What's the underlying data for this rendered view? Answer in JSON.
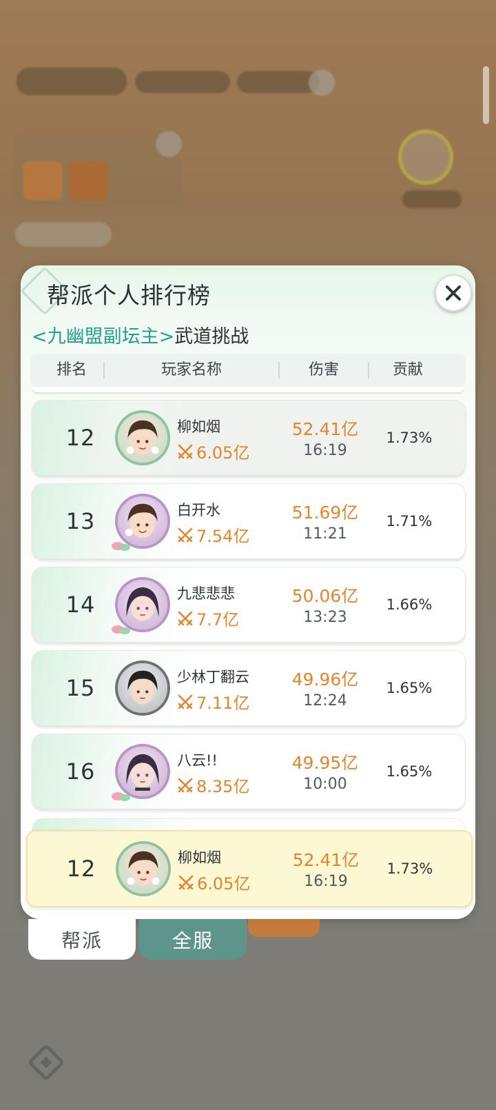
{
  "panel": {
    "title": "帮派个人排行榜",
    "subtitle_bracket": "<九幽盟副坛主>",
    "subtitle_rest": "武道挑战"
  },
  "columns": [
    "排名",
    "玩家名称",
    "伤害",
    "贡献"
  ],
  "rows": [
    {
      "rank": "12",
      "name": "柳如烟",
      "power": "6.05亿",
      "damage": "52.41亿",
      "time": "16:19",
      "share": "1.73%"
    },
    {
      "rank": "13",
      "name": "白开水",
      "power": "7.54亿",
      "damage": "51.69亿",
      "time": "11:21",
      "share": "1.71%"
    },
    {
      "rank": "14",
      "name": "九悲悲悲",
      "power": "7.7亿",
      "damage": "50.06亿",
      "time": "13:23",
      "share": "1.66%"
    },
    {
      "rank": "15",
      "name": "少林丁翻云",
      "power": "7.11亿",
      "damage": "49.96亿",
      "time": "12:24",
      "share": "1.65%"
    },
    {
      "rank": "16",
      "name": "八云!!",
      "power": "8.35亿",
      "damage": "49.95亿",
      "time": "10:00",
      "share": "1.65%"
    }
  ],
  "my_row": {
    "rank": "12",
    "name": "柳如烟",
    "power": "6.05亿",
    "damage": "52.41亿",
    "time": "16:19",
    "share": "1.73%"
  },
  "tabs": {
    "guild": "帮派",
    "server": "全服"
  },
  "icons": {
    "close": "close-icon",
    "power": "crossed-swords-icon",
    "bottom": "diamond-menu-icon"
  },
  "colors": {
    "accent_teal": "#23a08c",
    "value_orange": "#e3852c",
    "active_tab": "#5d958a",
    "my_row_bg": "#fcf8d4"
  }
}
